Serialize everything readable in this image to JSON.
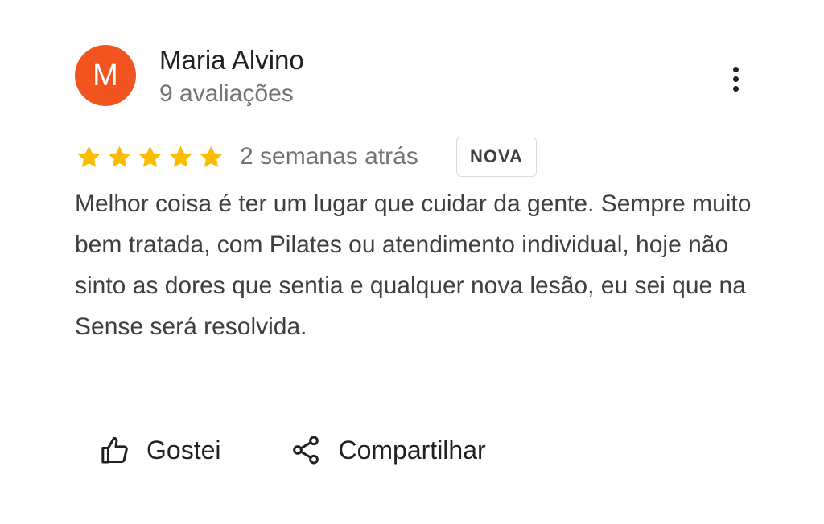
{
  "review": {
    "author_initial": "M",
    "author_name": "Maria Alvino",
    "review_count": "9 avaliações",
    "rating_stars": 5,
    "time_ago": "2 semanas atrás",
    "badge": "NOVA",
    "text": "Melhor coisa é ter um lugar que cuidar da gente. Sempre muito bem tratada, com Pilates ou atendimento individual, hoje não sinto as dores que sentia e qualquer nova lesão, eu sei que na Sense será resolvida."
  },
  "actions": {
    "like_label": "Gostei",
    "share_label": "Compartilhar"
  },
  "icons": {
    "more": "more-vertical-icon",
    "star": "star-icon",
    "like": "thumb-up-icon",
    "share": "share-icon"
  },
  "colors": {
    "avatar_bg": "#f2541f",
    "star": "#fbbc04",
    "secondary_text": "#70757a"
  }
}
